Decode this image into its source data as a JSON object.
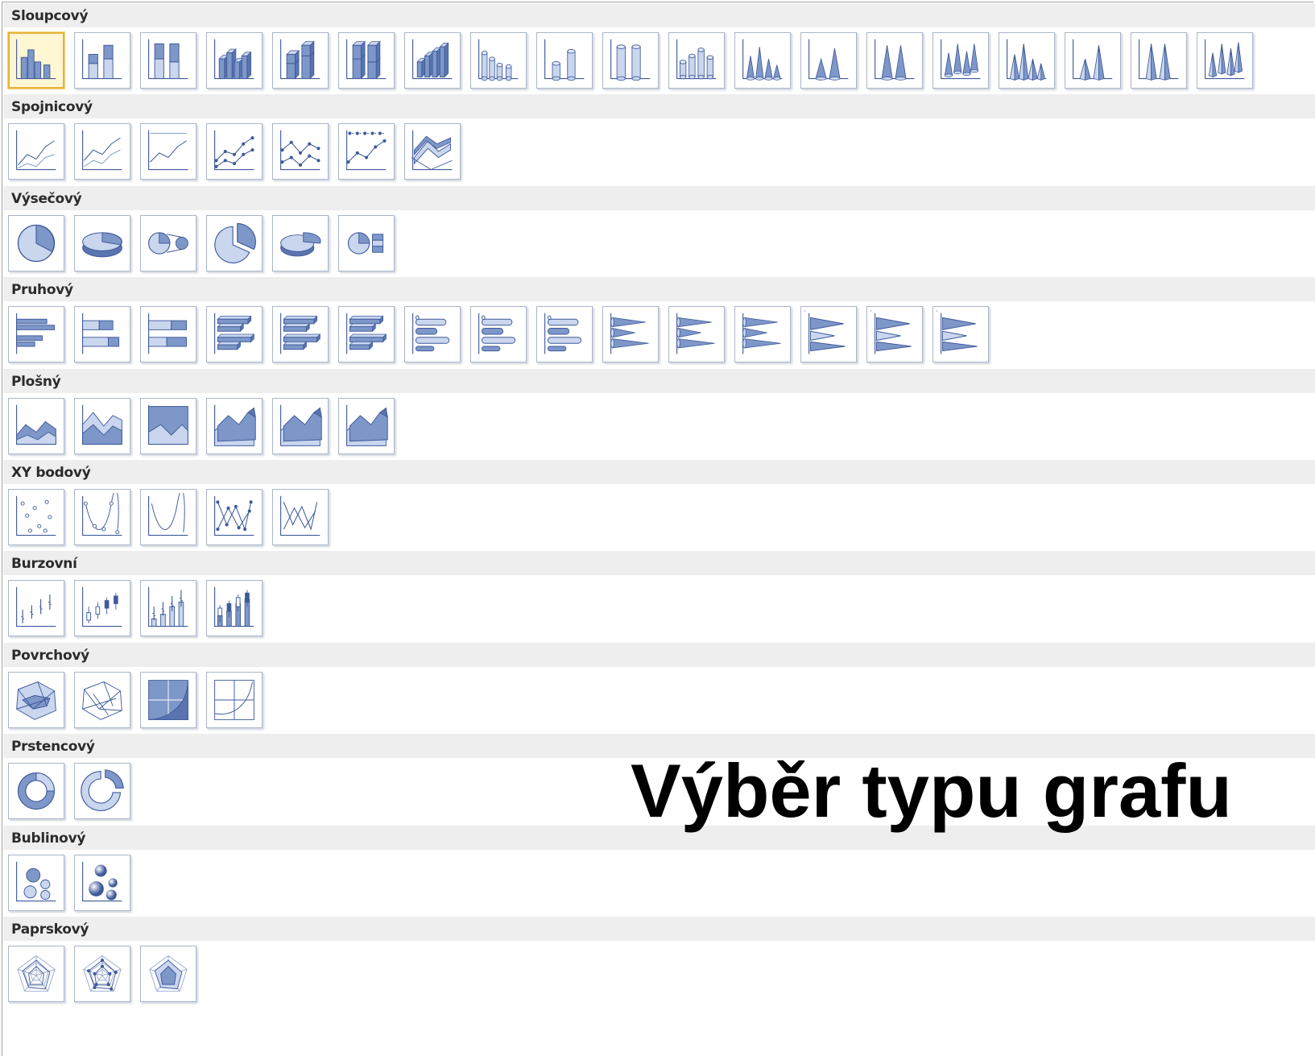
{
  "overlay_title": "Výběr typu grafu",
  "colors": {
    "section_bg": "#eeeeee",
    "tile_border": "#aab6c8",
    "icon_fill": "#7e97c9",
    "icon_fill_light": "#c9d6ee",
    "icon_stroke": "#3f5a9a",
    "selected_border": "#e7b23a"
  },
  "selected": {
    "section": 0,
    "index": 0
  },
  "sections": [
    {
      "title": "Sloupcový",
      "icons": [
        "clustered-column-icon",
        "stacked-column-icon",
        "100-stacked-column-icon",
        "3d-clustered-column-icon",
        "3d-stacked-column-icon",
        "3d-100-stacked-column-icon",
        "3d-column-icon",
        "clustered-cylinder-icon",
        "stacked-cylinder-icon",
        "100-stacked-cylinder-icon",
        "3d-cylinder-icon",
        "clustered-cone-icon",
        "stacked-cone-icon",
        "100-stacked-cone-icon",
        "3d-cone-icon",
        "clustered-pyramid-icon",
        "stacked-pyramid-icon",
        "100-stacked-pyramid-icon",
        "3d-pyramid-icon"
      ]
    },
    {
      "title": "Spojnicový",
      "icons": [
        "line-icon",
        "stacked-line-icon",
        "100-stacked-line-icon",
        "line-markers-icon",
        "stacked-line-markers-icon",
        "100-stacked-line-markers-icon",
        "3d-line-icon"
      ]
    },
    {
      "title": "Výsečový",
      "icons": [
        "pie-icon",
        "3d-pie-icon",
        "pie-of-pie-icon",
        "exploded-pie-icon",
        "3d-exploded-pie-icon",
        "bar-of-pie-icon"
      ]
    },
    {
      "title": "Pruhový",
      "icons": [
        "clustered-bar-icon",
        "stacked-bar-icon",
        "100-stacked-bar-icon",
        "3d-clustered-bar-icon",
        "3d-stacked-bar-icon",
        "3d-100-stacked-bar-icon",
        "clustered-horizontal-cylinder-icon",
        "stacked-horizontal-cylinder-icon",
        "100-stacked-horizontal-cylinder-icon",
        "clustered-horizontal-cone-icon",
        "stacked-horizontal-cone-icon",
        "100-stacked-horizontal-cone-icon",
        "clustered-horizontal-pyramid-icon",
        "stacked-horizontal-pyramid-icon",
        "100-stacked-horizontal-pyramid-icon"
      ]
    },
    {
      "title": "Plošný",
      "icons": [
        "area-icon",
        "stacked-area-icon",
        "100-stacked-area-icon",
        "3d-area-icon",
        "3d-stacked-area-icon",
        "3d-100-stacked-area-icon"
      ]
    },
    {
      "title": "XY bodový",
      "icons": [
        "scatter-markers-icon",
        "scatter-smooth-markers-icon",
        "scatter-smooth-lines-icon",
        "scatter-straight-markers-icon",
        "scatter-straight-lines-icon"
      ]
    },
    {
      "title": "Burzovní",
      "icons": [
        "stock-hlc-icon",
        "stock-ohlc-icon",
        "stock-vhlc-icon",
        "stock-vohlc-icon"
      ]
    },
    {
      "title": "Povrchový",
      "icons": [
        "3d-surface-icon",
        "wireframe-3d-surface-icon",
        "contour-icon",
        "wireframe-contour-icon"
      ]
    },
    {
      "title": "Prstencový",
      "icons": [
        "doughnut-icon",
        "exploded-doughnut-icon"
      ]
    },
    {
      "title": "Bublinový",
      "icons": [
        "bubble-icon",
        "3d-bubble-icon"
      ]
    },
    {
      "title": "Paprskový",
      "icons": [
        "radar-icon",
        "radar-markers-icon",
        "filled-radar-icon"
      ]
    }
  ]
}
